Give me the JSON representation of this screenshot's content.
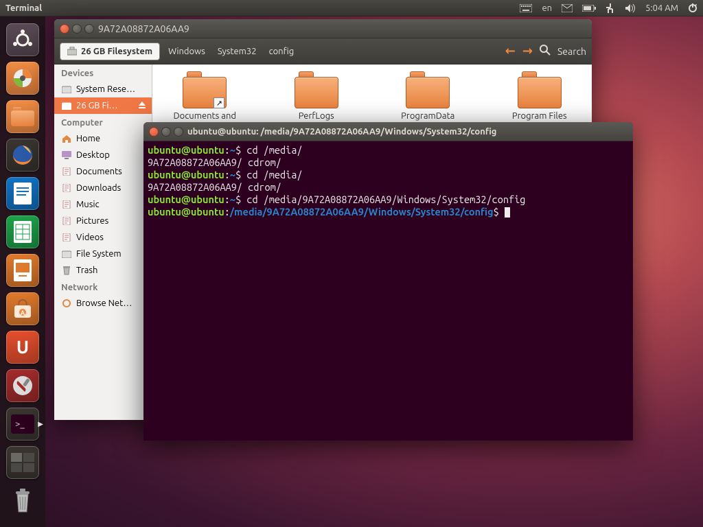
{
  "panel": {
    "active_app": "Terminal",
    "lang": "en",
    "time": "5:04 AM"
  },
  "launcher_items": [
    {
      "name": "dash",
      "color": "#5b4a55",
      "svg": "ubuntu"
    },
    {
      "name": "disk-analyzer",
      "color": "#f28c43",
      "svg": "disk"
    },
    {
      "name": "files",
      "color": "#f28c43",
      "svg": "folder"
    },
    {
      "name": "firefox",
      "color": "#3a3531",
      "svg": "firefox"
    },
    {
      "name": "writer",
      "color": "#1273c4",
      "svg": "doc"
    },
    {
      "name": "calc",
      "color": "#1ea14a",
      "svg": "sheet"
    },
    {
      "name": "impress",
      "color": "#e07a2c",
      "svg": "pres"
    },
    {
      "name": "software-center",
      "color": "#e07a2c",
      "svg": "bag"
    },
    {
      "name": "ubuntu-one",
      "color": "#e54f2d",
      "svg": "u1"
    },
    {
      "name": "settings",
      "color": "#a22c2c",
      "svg": "wrench"
    },
    {
      "name": "terminal-launcher",
      "color": "#3a3531",
      "svg": "term"
    },
    {
      "name": "workspace-switcher",
      "color": "#3a3531",
      "svg": "ws"
    },
    {
      "name": "trash",
      "color": "transparent",
      "svg": "trash"
    }
  ],
  "fm": {
    "title": "9A72A08872A06AA9",
    "crumb_active": "26 GB Filesystem",
    "crumbs": [
      "Windows",
      "System32",
      "config"
    ],
    "search": "Search",
    "sidebar": {
      "devices_head": "Devices",
      "devices": [
        "System Rese…",
        "26 GB Fi…"
      ],
      "computer_head": "Computer",
      "computer": [
        "Home",
        "Desktop",
        "Documents",
        "Downloads",
        "Music",
        "Pictures",
        "Videos",
        "File System",
        "Trash"
      ],
      "network_head": "Network",
      "network": [
        "Browse Net…"
      ]
    },
    "folders": [
      {
        "label": "Documents and\nSettings",
        "link": true
      },
      {
        "label": "PerfLogs"
      },
      {
        "label": "ProgramData"
      },
      {
        "label": "Program Files"
      }
    ]
  },
  "term": {
    "title": "ubuntu@ubuntu: /media/9A72A08872A06AA9/Windows/System32/config",
    "lines": [
      {
        "user": "ubuntu@ubuntu",
        "path": "~",
        "cmd": "cd /media/"
      },
      {
        "plain": "9A72A08872A06AA9/ cdrom/"
      },
      {
        "user": "ubuntu@ubuntu",
        "path": "~",
        "cmd": "cd /media/"
      },
      {
        "plain": "9A72A08872A06AA9/ cdrom/"
      },
      {
        "user": "ubuntu@ubuntu",
        "path": "~",
        "cmd": "cd /media/9A72A08872A06AA9/Windows/System32/config"
      },
      {
        "user": "ubuntu@ubuntu",
        "path": "/media/9A72A08872A06AA9/Windows/System32/config",
        "cmd": "",
        "cursor": true
      }
    ]
  }
}
